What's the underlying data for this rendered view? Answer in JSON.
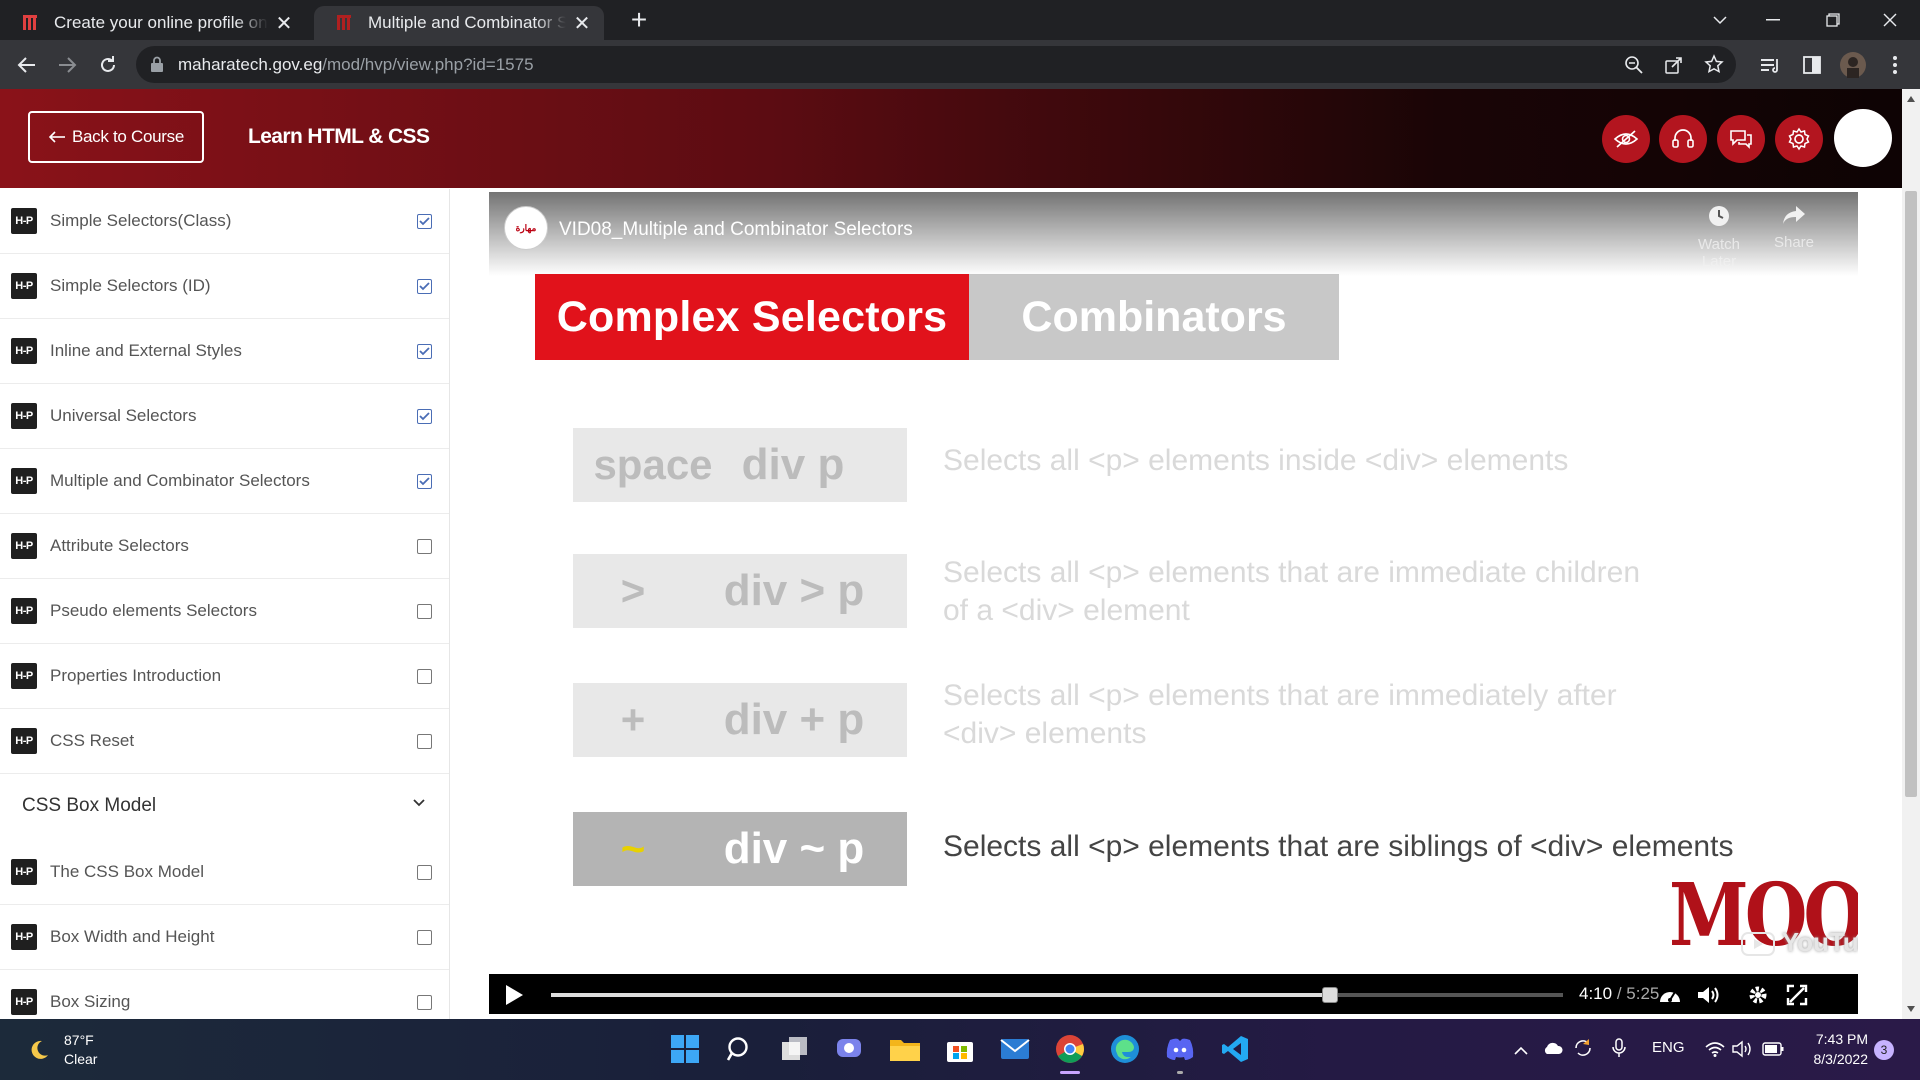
{
  "browser": {
    "tabs": [
      {
        "title": "Create your online profile on upwork",
        "active": false
      },
      {
        "title": "Multiple and Combinator Selectors",
        "active": true
      }
    ],
    "url_host": "maharatech.gov.eg",
    "url_path": "/mod/hvp/view.php?id=1575"
  },
  "header": {
    "back_label": "Back to Course",
    "course_title": "Learn HTML & CSS",
    "actions": [
      "eye-off-icon",
      "headset-icon",
      "chat-icon",
      "gear-icon"
    ]
  },
  "sidebar": {
    "items": [
      {
        "icon": "H-P",
        "label": "Simple Selectors(Class)",
        "done": true
      },
      {
        "icon": "H-P",
        "label": "Simple Selectors (ID)",
        "done": true
      },
      {
        "icon": "H-P",
        "label": "Inline and External Styles",
        "done": true
      },
      {
        "icon": "H-P",
        "label": "Universal Selectors",
        "done": true
      },
      {
        "icon": "H-P",
        "label": "Multiple and Combinator Selectors",
        "done": true
      },
      {
        "icon": "H-P",
        "label": "Attribute Selectors",
        "done": false
      },
      {
        "icon": "H-P",
        "label": "Pseudo elements Selectors",
        "done": false
      },
      {
        "icon": "H-P",
        "label": "Properties Introduction",
        "done": false
      },
      {
        "icon": "H-P",
        "label": "CSS Reset",
        "done": false
      }
    ],
    "section": {
      "label": "CSS Box Model"
    },
    "section_items": [
      {
        "icon": "H-P",
        "label": "The CSS Box Model",
        "done": false
      },
      {
        "icon": "H-P",
        "label": "Box Width and Height",
        "done": false
      },
      {
        "icon": "H-P",
        "label": "Box Sizing",
        "done": false
      }
    ]
  },
  "video": {
    "title": "VID08_Multiple and Combinator Selectors",
    "watch_later": "Watch Later",
    "share": "Share",
    "slide": {
      "tab_active": "Complex Selectors",
      "tab_inactive": "Combinators",
      "rows": [
        {
          "symbol": "space",
          "code": "div p",
          "desc": "Selects all <p> elements inside <div> elements",
          "active": false
        },
        {
          "symbol": ">",
          "code": "div > p",
          "desc": "Selects all <p> elements  that are immediate children of a <div> element",
          "active": false
        },
        {
          "symbol": "+",
          "code": "div + p",
          "desc": "Selects all <p> elements  that are immediately after <div> elements",
          "active": false
        },
        {
          "symbol": "~",
          "code": "div ~ p",
          "desc": "Selects all <p> elements that are siblings of <div> elements",
          "active": true
        }
      ],
      "watermark": "MOOCA",
      "youtube_mark": "YouTube"
    },
    "current_time": "4:10",
    "duration": "5:25",
    "progress": 0.77
  },
  "taskbar": {
    "temperature": "87°F",
    "condition": "Clear",
    "language": "ENG",
    "time": "7:43 PM",
    "date": "8/3/2022",
    "notifications": "3"
  },
  "colors": {
    "brand_red": "#b3151f",
    "accent_blue": "#4a6db5"
  }
}
